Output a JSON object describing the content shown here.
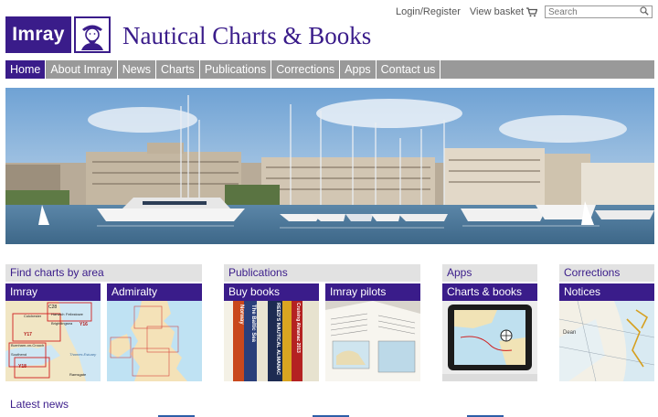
{
  "header": {
    "logo_text": "Imray",
    "site_title": "Nautical Charts & Books",
    "login_label": "Login/Register",
    "basket_label": "View basket",
    "search_placeholder": "Search"
  },
  "nav": {
    "items": [
      {
        "label": "Home",
        "active": true
      },
      {
        "label": "About Imray"
      },
      {
        "label": "News"
      },
      {
        "label": "Charts"
      },
      {
        "label": "Publications"
      },
      {
        "label": "Corrections"
      },
      {
        "label": "Apps"
      },
      {
        "label": "Contact us"
      }
    ]
  },
  "sections": {
    "charts": {
      "title": "Find charts by area",
      "tiles": [
        {
          "label": "Imray",
          "map_labels": [
            "C28",
            "Y16",
            "Y17",
            "Y18",
            "Felixstowe",
            "Colchester",
            "Brightlingsea",
            "Harwich",
            "Southend",
            "Thames Estuary",
            "Ramsgate",
            "Burnham-on-Crouch"
          ]
        },
        {
          "label": "Admiralty"
        }
      ]
    },
    "publications": {
      "title": "Publications",
      "tiles": [
        {
          "label": "Buy books",
          "spines": [
            "Norway",
            "The Baltic Sea",
            "REED'S NAUTICAL ALMANAC",
            "Cruising Almanac 2013"
          ]
        },
        {
          "label": "Imray pilots"
        }
      ]
    },
    "apps": {
      "title": "Apps",
      "tiles": [
        {
          "label": "Charts & books"
        }
      ]
    },
    "corrections": {
      "title": "Corrections",
      "tiles": [
        {
          "label": "Notices",
          "map_labels": [
            "Dean"
          ]
        }
      ]
    }
  },
  "latest_news": {
    "title": "Latest news"
  },
  "colors": {
    "brand": "#3a1c8a",
    "nav_bg": "#999999",
    "section_bg": "#e2e2e2"
  }
}
